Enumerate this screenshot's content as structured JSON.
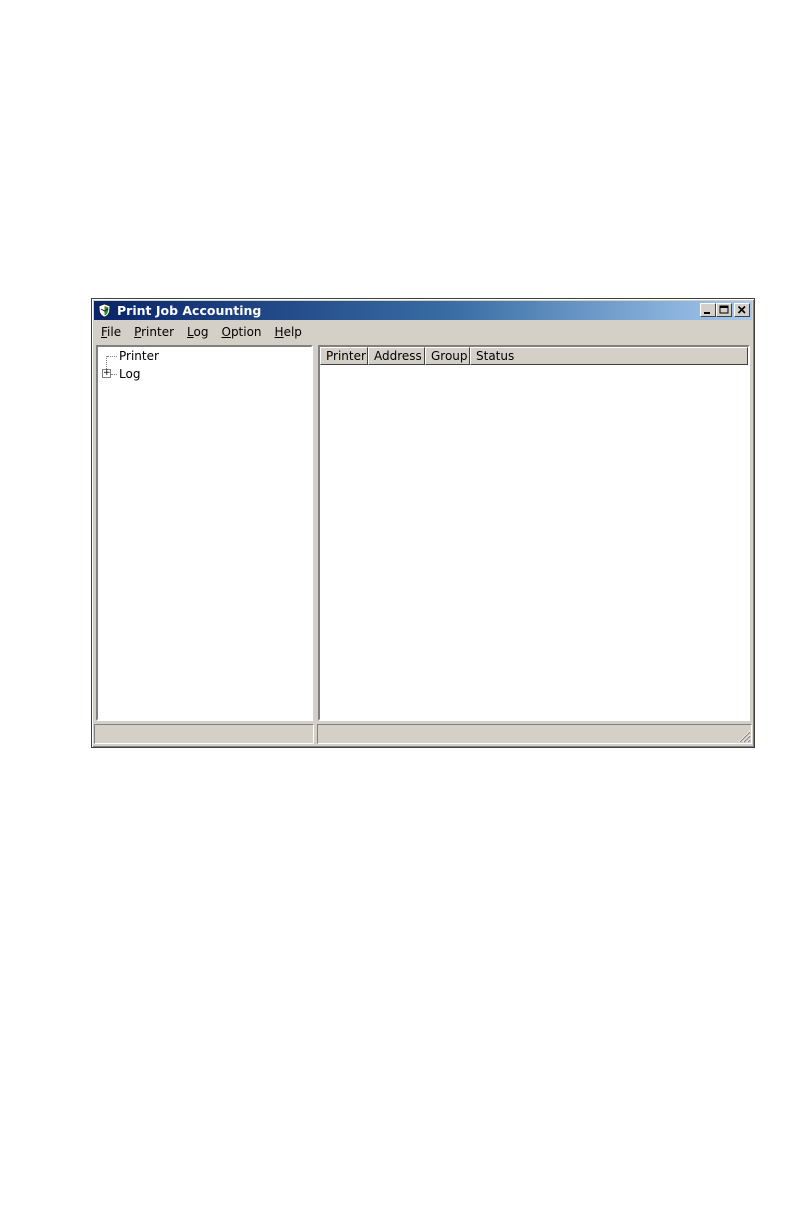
{
  "window": {
    "title": "Print Job Accounting",
    "controls": {
      "minimize": "_",
      "maximize": "□",
      "close": "×"
    }
  },
  "menu": [
    {
      "mnemonic": "F",
      "rest": "ile"
    },
    {
      "mnemonic": "P",
      "rest": "rinter"
    },
    {
      "mnemonic": "L",
      "rest": "og"
    },
    {
      "mnemonic": "O",
      "rest": "ption"
    },
    {
      "mnemonic": "H",
      "rest": "elp"
    }
  ],
  "tree": {
    "items": [
      {
        "label": "Printer",
        "expandable": false
      },
      {
        "label": "Log",
        "expandable": true,
        "expander": "+"
      }
    ]
  },
  "list": {
    "columns": [
      "Printer",
      "Address",
      "Group",
      "Status"
    ],
    "rows": []
  },
  "status_bar": {
    "left_text": "",
    "right_text": ""
  },
  "icons": {
    "app": "app-shield-icon",
    "grip": "resize-grip-icon"
  },
  "colors": {
    "titlebar_start": "#0a246a",
    "titlebar_end": "#a6caf0",
    "face": "#d4d0c8"
  }
}
